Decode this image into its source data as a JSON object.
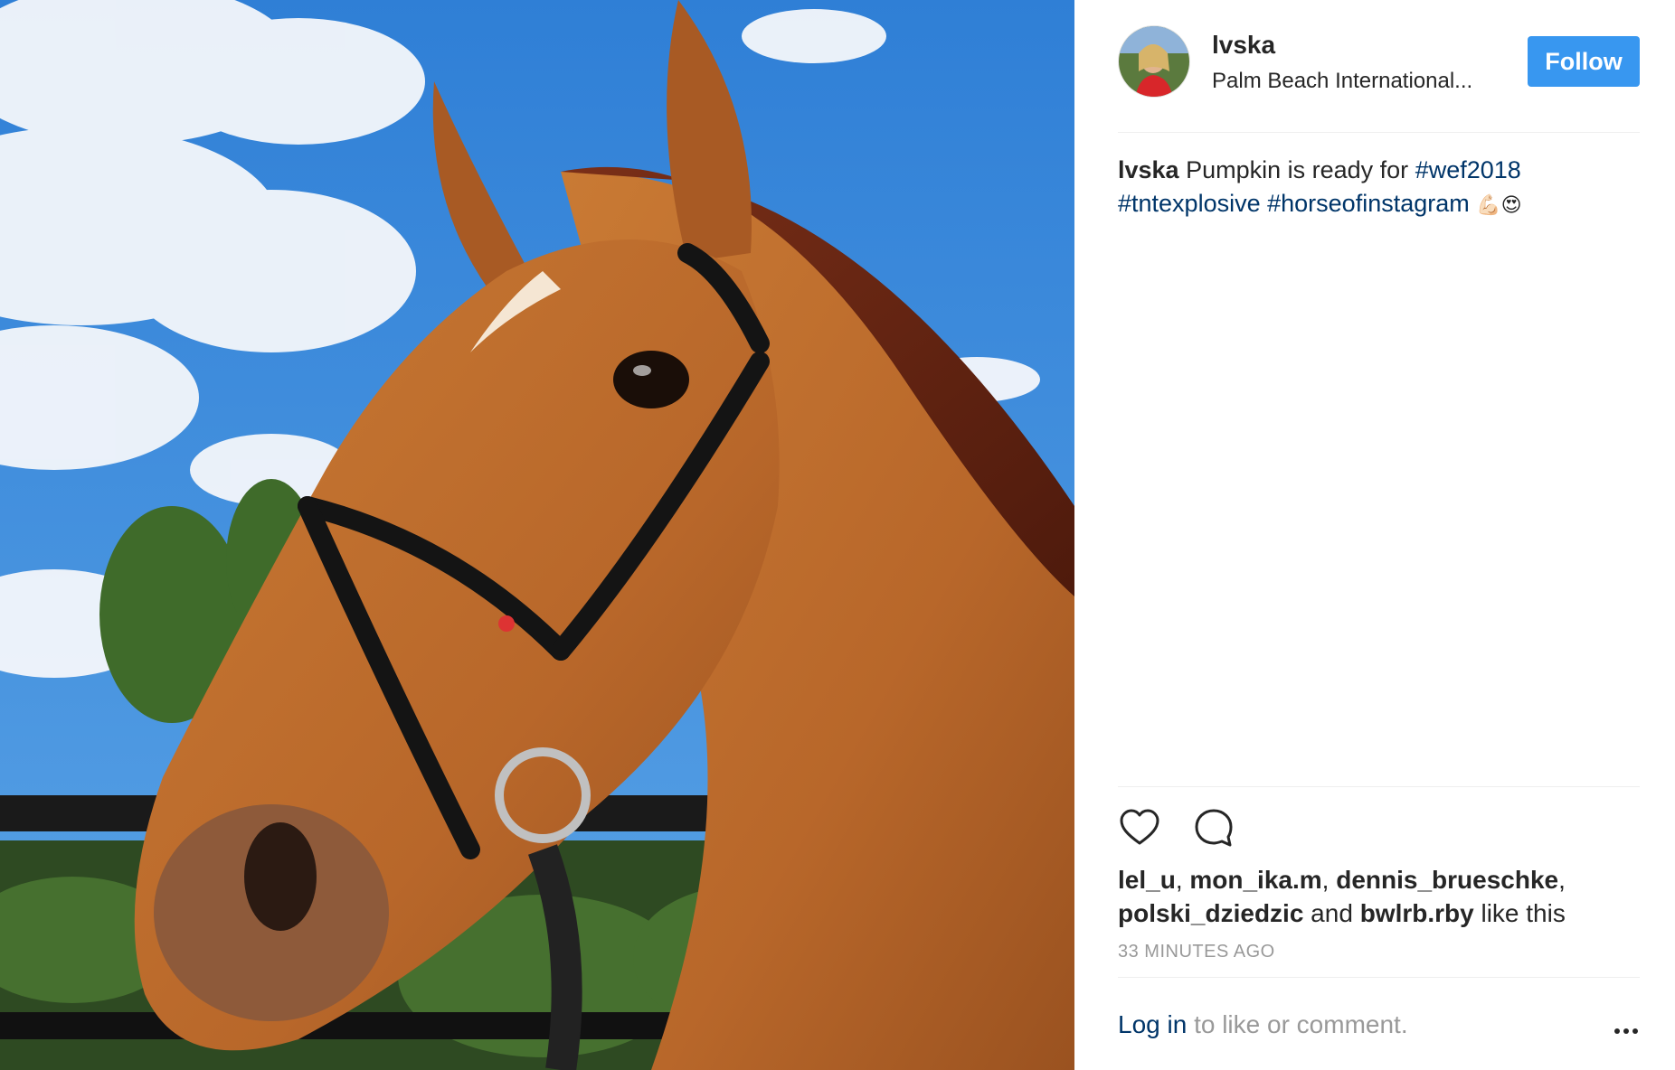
{
  "photo": {
    "subject_icon": "horse-photo"
  },
  "header": {
    "username": "lvska",
    "location": "Palm Beach International...",
    "follow_label": "Follow"
  },
  "caption": {
    "username": "lvska",
    "text": " Pumpkin is ready for ",
    "tags": [
      "#wef2018",
      "#tntexplosive",
      "#horseofinstagram"
    ],
    "emojis": "💪🏻😍"
  },
  "likes": {
    "users": [
      "lel_u",
      "mon_ika.m",
      "dennis_brueschke",
      "polski_dziedzic"
    ],
    "separator": ", ",
    "and_text": " and ",
    "last_user": "bwlrb.rby",
    "suffix": " like this"
  },
  "timestamp": "33 MINUTES AGO",
  "footer": {
    "login_label": "Log in",
    "rest": " to like or comment."
  },
  "colors": {
    "follow_button": "#3897f0",
    "link": "#003569",
    "muted": "#999999"
  }
}
